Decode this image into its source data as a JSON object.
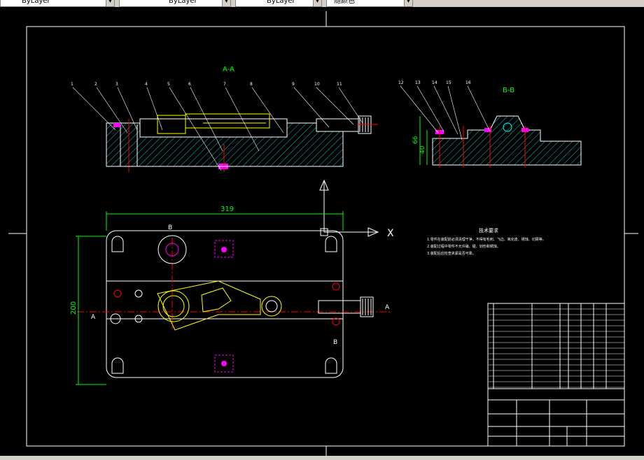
{
  "toolbar": {
    "linetype_value": "ByLayer",
    "lineweight_value": "ByLayer",
    "plotstyle_value": "ByLayer",
    "color_value": "随颜色"
  },
  "colors": {
    "background": "#000000",
    "outline": "#ffffff",
    "hatch": "#00ffff",
    "part": "#ffff00",
    "dimension": "#00ff00",
    "highlight": "#ff00ff",
    "accent": "#ff0000"
  },
  "drawing": {
    "section_aa": "A-A",
    "section_bb": "B-B",
    "dim_length": "319",
    "dim_width": "200",
    "dim_height_66": "66",
    "dim_height_40": "40",
    "label_a_left": "A",
    "label_a_right": "A",
    "label_b_top": "B",
    "label_b_bottom": "B",
    "balloons_aa": [
      "1",
      "2",
      "3",
      "4",
      "5",
      "6",
      "7",
      "8",
      "9",
      "10",
      "11"
    ],
    "balloons_bb": [
      "12",
      "13",
      "14",
      "15",
      "16"
    ],
    "tech_title": "技术要求",
    "tech_notes": [
      "1.零件在装配前必须清理干净，不得有毛刺、飞边、氧化皮、锈蚀、切屑等。",
      "2.装配过程中零件不允许磕、碰、划伤和锈蚀。",
      "3.装配后应检查夹紧是否可靠。"
    ],
    "axis_x_label": "X"
  }
}
